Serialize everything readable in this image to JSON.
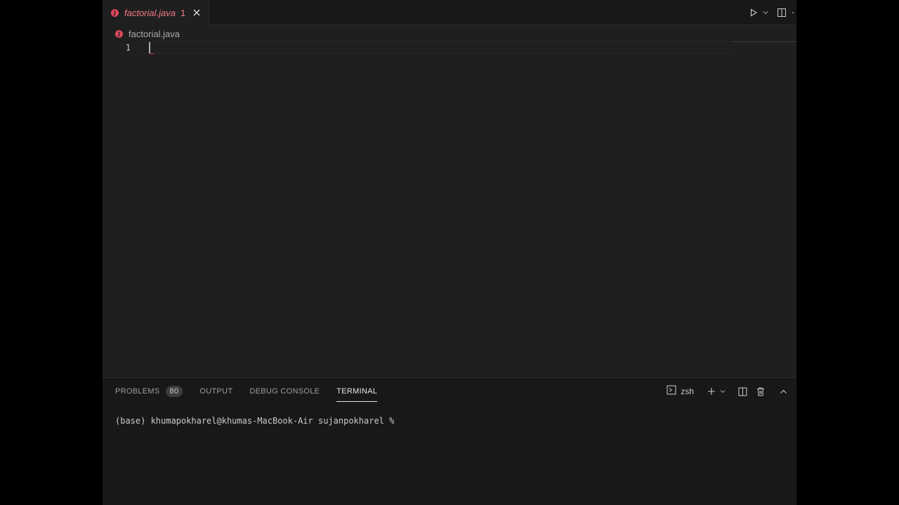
{
  "tabbar": {
    "tab": {
      "icon": "java-error-icon",
      "icon_glyph": "J",
      "label": "factorial.java",
      "problem_count": "1"
    }
  },
  "breadcrumb": {
    "icon_glyph": "J",
    "file": "factorial.java"
  },
  "editor": {
    "line_numbers": [
      "1"
    ]
  },
  "panel": {
    "tabs": [
      {
        "label": "PROBLEMS",
        "badge": "80"
      },
      {
        "label": "OUTPUT"
      },
      {
        "label": "DEBUG CONSOLE"
      },
      {
        "label": "TERMINAL"
      }
    ],
    "active_tab": "TERMINAL",
    "shell": "zsh"
  },
  "terminal": {
    "prompt": "(base) khumapokharel@khumas-MacBook-Air sujanpokharel % "
  },
  "colors": {
    "error": "#e0485c",
    "tab_label": "#f47b87",
    "background": "#1f1f1f"
  }
}
